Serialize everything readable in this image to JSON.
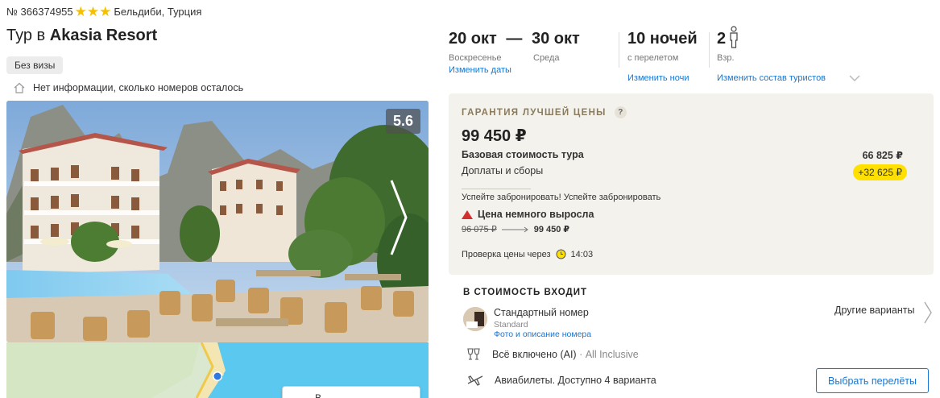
{
  "header": {
    "tour_number": "№ 366374955",
    "stars": 3,
    "location": "Бельдиби, Турция",
    "title_prefix": "Тур в",
    "hotel_name": "Akasia Resort",
    "visa_badge": "Без визы",
    "rooms_info": "Нет информации, сколько номеров осталось"
  },
  "photo": {
    "rating": "5.6"
  },
  "map": {
    "button_label": "В"
  },
  "dates": {
    "start": "20 окт",
    "dash": "—",
    "end": "30 окт",
    "start_day": "Воскресенье",
    "end_day": "Среда",
    "change_dates": "Изменить даты"
  },
  "nights": {
    "value": "10 ночей",
    "subtitle": "с перелетом",
    "change": "Изменить ночи"
  },
  "tourists": {
    "count": "2",
    "subtitle": "Взр.",
    "change": "Изменить состав туристов"
  },
  "price": {
    "guarantee": "ГАРАНТИЯ ЛУЧШЕЙ ЦЕНЫ",
    "question": "?",
    "total": "99 450 ₽",
    "base_label": "Базовая стоимость тура",
    "base_value": "66 825 ₽",
    "fees_label": "Доплаты и сборы",
    "fees_value": "+32 625 ₽",
    "hurry": "Успейте забронировать! Успейте забронировать",
    "rise": "Цена немного выросла",
    "old_price": "96 075 ₽",
    "new_price": "99 450 ₽",
    "check_label": "Проверка цены через",
    "check_time": "14:03"
  },
  "included": {
    "title": "В СТОИМОСТЬ ВХОДИТ",
    "room_name": "Стандартный номер",
    "room_type": "Standard",
    "room_link": "Фото и описание номера",
    "other_options": "Другие варианты",
    "meal": "Всё включено (AI)",
    "meal_extra": "· All Inclusive",
    "flights": "Авиабилеты. Доступно 4 варианта",
    "choose_flights": "Выбрать перелёты"
  },
  "colors": {
    "accent_link": "#1976d2",
    "fee_highlight": "#ffe000",
    "price_card_bg": "#f4f2ed",
    "star": "#f4c000",
    "price_rise": "#d32f2f"
  }
}
